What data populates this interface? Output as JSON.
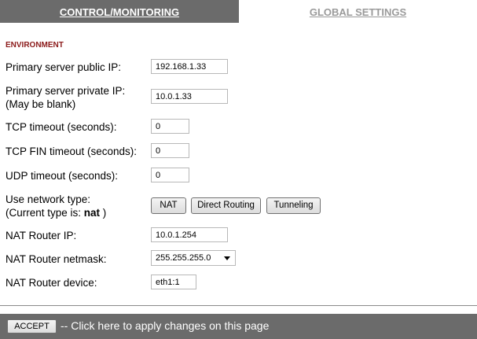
{
  "tabs": {
    "control": "CONTROL/MONITORING",
    "global": "GLOBAL SETTINGS"
  },
  "section_title": "ENVIRONMENT",
  "fields": {
    "primary_public": {
      "label": "Primary server public IP:",
      "value": "192.168.1.33"
    },
    "primary_private": {
      "label": "Primary server private IP:",
      "note": "(May be blank)",
      "value": "10.0.1.33"
    },
    "tcp_timeout": {
      "label": "TCP timeout (seconds):",
      "value": "0"
    },
    "tcp_fin_timeout": {
      "label": "TCP FIN timeout (seconds):",
      "value": "0"
    },
    "udp_timeout": {
      "label": "UDP timeout (seconds):",
      "value": "0"
    },
    "network_type": {
      "label": "Use network type:",
      "current_prefix": "(Current type is: ",
      "current_value": "nat",
      "current_suffix": " )"
    },
    "nat_router_ip": {
      "label": "NAT Router IP:",
      "value": "10.0.1.254"
    },
    "nat_router_netmask": {
      "label": "NAT Router netmask:",
      "value": "255.255.255.0"
    },
    "nat_router_device": {
      "label": "NAT Router device:",
      "value": "eth1:1"
    }
  },
  "network_buttons": {
    "nat": "NAT",
    "direct_routing": "Direct Routing",
    "tunneling": "Tunneling"
  },
  "footer": {
    "accept": "ACCEPT",
    "text": "-- Click here to apply changes on this page"
  }
}
